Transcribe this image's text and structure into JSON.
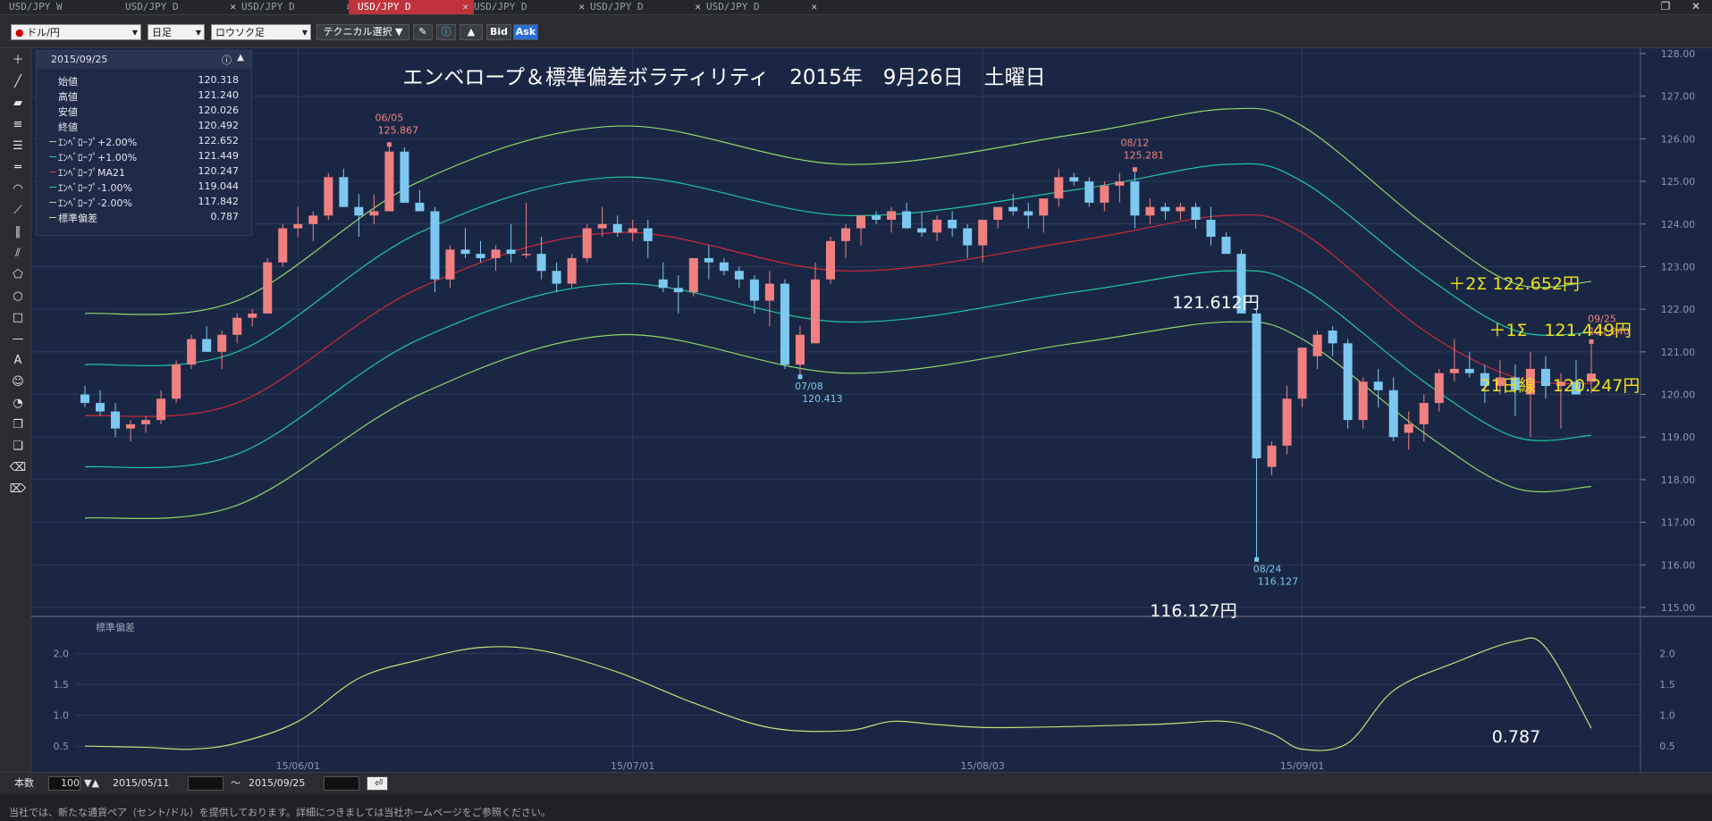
{
  "tabs": [
    {
      "label": "USD/JPY W",
      "active": false
    },
    {
      "label": "USD/JPY D",
      "active": false
    },
    {
      "label": "USD/JPY D",
      "active": false
    },
    {
      "label": "USD/JPY D",
      "active": true
    },
    {
      "label": "USD/JPY D",
      "active": false
    },
    {
      "label": "USD/JPY D",
      "active": false
    },
    {
      "label": "USD/JPY D",
      "active": false
    }
  ],
  "toolbar": {
    "pair": "ドル/円",
    "timeframe": "日足",
    "chart_style": "ロウソク足",
    "technical": "テクニカル選択",
    "bid": "Bid",
    "ask": "Ask"
  },
  "info_panel": {
    "date": "2015/09/25",
    "rows": [
      {
        "label": "始値",
        "value": "120.318",
        "color": ""
      },
      {
        "label": "高値",
        "value": "121.240",
        "color": ""
      },
      {
        "label": "安値",
        "value": "120.026",
        "color": ""
      },
      {
        "label": "終値",
        "value": "120.492",
        "color": ""
      },
      {
        "label": "ｴﾝﾍﾞﾛｰﾌﾟ+2.00%",
        "value": "122.652",
        "color": "#9be07a"
      },
      {
        "label": "ｴﾝﾍﾞﾛｰﾌﾟ+1.00%",
        "value": "121.449",
        "color": "#1fd0a0"
      },
      {
        "label": "ｴﾝﾍﾞﾛｰﾌﾟMA21",
        "value": "120.247",
        "color": "#e0303c"
      },
      {
        "label": "ｴﾝﾍﾞﾛｰﾌﾟ-1.00%",
        "value": "119.044",
        "color": "#1fd0a0"
      },
      {
        "label": "ｴﾝﾍﾞﾛｰﾌﾟ-2.00%",
        "value": "117.842",
        "color": "#9be07a"
      },
      {
        "label": "標準偏差",
        "value": "0.787",
        "color": "#c8e07a"
      }
    ]
  },
  "bottom": {
    "count_label": "本数",
    "count": "100",
    "from": "2015/05/11",
    "tilde": "～",
    "to": "2015/09/25"
  },
  "status_text": "当社では、新たな通貨ペア（セント/ドル）を提供しております。詳細につきましては当社ホームページをご参照ください。",
  "chart_data": {
    "type": "candlestick",
    "title": "エンベロープ＆標準偏差ボラティリティ　2015年　9月26日　土曜日",
    "ylim": [
      115,
      128
    ],
    "yticks": [
      "128.00",
      "127.00",
      "126.00",
      "125.00",
      "124.00",
      "123.00",
      "122.00",
      "121.00",
      "120.00",
      "119.00",
      "118.00",
      "117.00",
      "116.00",
      "115.00"
    ],
    "xticks": [
      "15/06/01",
      "15/07/01",
      "15/08/03",
      "15/09/01"
    ],
    "up_color": "#f08080",
    "down_color": "#7cc8f0",
    "candles": [
      [
        120.0,
        120.2,
        119.7,
        119.8
      ],
      [
        119.8,
        120.1,
        119.5,
        119.6
      ],
      [
        119.6,
        119.8,
        119.0,
        119.2
      ],
      [
        119.2,
        119.4,
        118.9,
        119.3
      ],
      [
        119.3,
        119.5,
        119.1,
        119.4
      ],
      [
        119.4,
        120.1,
        119.3,
        119.9
      ],
      [
        119.9,
        120.8,
        119.8,
        120.7
      ],
      [
        120.7,
        121.4,
        120.6,
        121.3
      ],
      [
        121.3,
        121.6,
        121.0,
        121.0
      ],
      [
        121.0,
        121.5,
        120.6,
        121.4
      ],
      [
        121.4,
        121.9,
        121.2,
        121.8
      ],
      [
        121.8,
        122.0,
        121.6,
        121.9
      ],
      [
        121.9,
        123.2,
        121.9,
        123.1
      ],
      [
        123.1,
        124.0,
        123.0,
        123.9
      ],
      [
        123.9,
        124.4,
        123.7,
        124.0
      ],
      [
        124.0,
        124.3,
        123.6,
        124.2
      ],
      [
        124.2,
        125.2,
        124.1,
        125.1
      ],
      [
        125.1,
        125.3,
        124.5,
        124.4
      ],
      [
        124.4,
        124.7,
        123.7,
        124.2
      ],
      [
        124.2,
        124.7,
        124.0,
        124.3
      ],
      [
        124.3,
        125.9,
        124.3,
        125.7
      ],
      [
        125.7,
        125.8,
        124.6,
        124.5
      ],
      [
        124.5,
        124.8,
        124.3,
        124.3
      ],
      [
        124.3,
        124.4,
        122.4,
        122.7
      ],
      [
        122.7,
        123.5,
        122.5,
        123.4
      ],
      [
        123.4,
        123.9,
        123.2,
        123.3
      ],
      [
        123.3,
        123.6,
        123.1,
        123.2
      ],
      [
        123.2,
        123.5,
        122.9,
        123.4
      ],
      [
        123.4,
        124.0,
        123.1,
        123.3
      ],
      [
        123.3,
        124.5,
        123.2,
        123.3
      ],
      [
        123.3,
        123.7,
        122.7,
        122.9
      ],
      [
        122.9,
        123.1,
        122.4,
        122.6
      ],
      [
        122.6,
        123.3,
        122.5,
        123.2
      ],
      [
        123.2,
        124.0,
        123.1,
        123.9
      ],
      [
        123.9,
        124.4,
        123.7,
        124.0
      ],
      [
        124.0,
        124.2,
        123.7,
        123.8
      ],
      [
        123.8,
        124.1,
        123.6,
        123.9
      ],
      [
        123.9,
        124.1,
        123.2,
        123.6
      ],
      [
        122.7,
        123.1,
        122.4,
        122.5
      ],
      [
        122.5,
        122.8,
        121.9,
        122.4
      ],
      [
        122.4,
        123.1,
        122.3,
        123.2
      ],
      [
        123.2,
        123.5,
        122.7,
        123.1
      ],
      [
        123.1,
        123.2,
        122.8,
        122.9
      ],
      [
        122.9,
        123.0,
        122.5,
        122.7
      ],
      [
        122.7,
        122.8,
        121.9,
        122.2
      ],
      [
        122.2,
        122.9,
        121.6,
        122.6
      ],
      [
        122.6,
        122.7,
        120.6,
        120.7
      ],
      [
        120.7,
        121.6,
        120.41,
        121.4
      ],
      [
        121.2,
        123.1,
        121.2,
        122.7
      ],
      [
        122.7,
        123.7,
        122.6,
        123.6
      ],
      [
        123.6,
        124.0,
        123.2,
        123.9
      ],
      [
        123.9,
        124.1,
        123.5,
        124.2
      ],
      [
        124.2,
        124.3,
        124.0,
        124.1
      ],
      [
        124.1,
        124.4,
        123.8,
        124.3
      ],
      [
        124.3,
        124.5,
        123.9,
        123.9
      ],
      [
        123.9,
        124.3,
        123.7,
        123.8
      ],
      [
        123.8,
        124.2,
        123.6,
        124.1
      ],
      [
        124.1,
        124.3,
        123.7,
        123.9
      ],
      [
        123.9,
        124.0,
        123.2,
        123.5
      ],
      [
        123.5,
        124.0,
        123.1,
        124.1
      ],
      [
        124.1,
        124.4,
        123.9,
        124.4
      ],
      [
        124.4,
        124.7,
        124.2,
        124.3
      ],
      [
        124.3,
        124.5,
        123.9,
        124.2
      ],
      [
        124.2,
        124.6,
        123.8,
        124.6
      ],
      [
        124.6,
        125.3,
        124.4,
        125.1
      ],
      [
        125.1,
        125.2,
        124.9,
        125.0
      ],
      [
        125.0,
        125.1,
        124.4,
        124.5
      ],
      [
        124.5,
        125.0,
        124.3,
        124.9
      ],
      [
        124.9,
        125.2,
        124.5,
        125.0
      ],
      [
        125.0,
        125.28,
        123.9,
        124.2
      ],
      [
        124.2,
        124.6,
        124.0,
        124.4
      ],
      [
        124.4,
        124.5,
        124.1,
        124.3
      ],
      [
        124.3,
        124.5,
        124.1,
        124.4
      ],
      [
        124.4,
        124.5,
        123.9,
        124.1
      ],
      [
        124.1,
        124.4,
        123.5,
        123.7
      ],
      [
        123.7,
        123.8,
        123.3,
        123.3
      ],
      [
        123.3,
        123.4,
        121.9,
        121.9
      ],
      [
        121.9,
        122.0,
        116.13,
        118.5
      ],
      [
        118.3,
        118.9,
        118.1,
        118.8
      ],
      [
        118.8,
        120.2,
        118.6,
        119.9
      ],
      [
        119.9,
        121.1,
        119.7,
        121.1
      ],
      [
        120.9,
        121.5,
        120.6,
        121.4
      ],
      [
        121.5,
        121.6,
        120.9,
        121.2
      ],
      [
        121.2,
        121.3,
        119.2,
        119.4
      ],
      [
        119.4,
        120.4,
        119.2,
        120.3
      ],
      [
        120.3,
        120.6,
        119.7,
        120.1
      ],
      [
        120.1,
        120.4,
        118.9,
        119.0
      ],
      [
        119.1,
        119.6,
        118.7,
        119.3
      ],
      [
        119.3,
        120.0,
        118.9,
        119.8
      ],
      [
        119.8,
        120.6,
        119.6,
        120.5
      ],
      [
        120.5,
        121.3,
        120.3,
        120.6
      ],
      [
        120.6,
        121.0,
        120.4,
        120.5
      ],
      [
        120.5,
        120.7,
        119.8,
        120.2
      ],
      [
        120.2,
        120.8,
        120.0,
        120.4
      ],
      [
        120.4,
        120.7,
        119.5,
        120.1
      ],
      [
        120.0,
        121.0,
        119.0,
        120.6
      ],
      [
        120.6,
        120.9,
        119.9,
        120.2
      ],
      [
        120.2,
        120.5,
        119.2,
        120.3
      ],
      [
        120.3,
        120.8,
        120.0,
        120.0
      ],
      [
        120.3,
        121.24,
        120.03,
        120.49
      ]
    ],
    "envelope": {
      "ma21": [
        [
          0,
          119.5
        ],
        [
          10,
          119.8
        ],
        [
          22,
          122.5
        ],
        [
          35,
          123.8
        ],
        [
          50,
          122.9
        ],
        [
          65,
          123.6
        ],
        [
          75,
          124.2
        ],
        [
          80,
          123.8
        ],
        [
          88,
          121.5
        ],
        [
          94,
          120.4
        ],
        [
          99,
          120.25
        ]
      ],
      "plus1": [
        [
          0,
          120.7
        ],
        [
          10,
          121.0
        ],
        [
          22,
          123.8
        ],
        [
          35,
          125.1
        ],
        [
          50,
          124.2
        ],
        [
          65,
          124.8
        ],
        [
          75,
          125.4
        ],
        [
          80,
          125.0
        ],
        [
          88,
          122.8
        ],
        [
          94,
          121.5
        ],
        [
          99,
          121.45
        ]
      ],
      "plus2": [
        [
          0,
          121.9
        ],
        [
          10,
          122.2
        ],
        [
          22,
          125.0
        ],
        [
          35,
          126.3
        ],
        [
          50,
          125.4
        ],
        [
          65,
          126.1
        ],
        [
          75,
          126.7
        ],
        [
          80,
          126.3
        ],
        [
          88,
          124.0
        ],
        [
          94,
          122.6
        ],
        [
          99,
          122.65
        ]
      ],
      "minus1": [
        [
          0,
          118.3
        ],
        [
          10,
          118.6
        ],
        [
          22,
          121.3
        ],
        [
          35,
          122.6
        ],
        [
          50,
          121.7
        ],
        [
          65,
          122.4
        ],
        [
          75,
          122.9
        ],
        [
          80,
          122.5
        ],
        [
          88,
          120.3
        ],
        [
          94,
          119.0
        ],
        [
          99,
          119.04
        ]
      ],
      "minus2": [
        [
          0,
          117.1
        ],
        [
          10,
          117.4
        ],
        [
          22,
          120.0
        ],
        [
          35,
          121.4
        ],
        [
          50,
          120.5
        ],
        [
          65,
          121.2
        ],
        [
          75,
          121.7
        ],
        [
          80,
          121.3
        ],
        [
          88,
          119.1
        ],
        [
          94,
          117.8
        ],
        [
          99,
          117.84
        ]
      ]
    },
    "sd": {
      "label": "標準偏差",
      "ylim": [
        0.3,
        2.4
      ],
      "yticks": [
        "2.0",
        "1.5",
        "1.0",
        "0.5"
      ],
      "values": [
        [
          0,
          0.5
        ],
        [
          4,
          0.48
        ],
        [
          7,
          0.45
        ],
        [
          10,
          0.55
        ],
        [
          14,
          0.9
        ],
        [
          18,
          1.6
        ],
        [
          22,
          1.9
        ],
        [
          26,
          2.1
        ],
        [
          30,
          2.05
        ],
        [
          35,
          1.7
        ],
        [
          40,
          1.2
        ],
        [
          45,
          0.8
        ],
        [
          50,
          0.75
        ],
        [
          53,
          0.9
        ],
        [
          56,
          0.85
        ],
        [
          60,
          0.8
        ],
        [
          70,
          0.85
        ],
        [
          75,
          0.9
        ],
        [
          78,
          0.7
        ],
        [
          80,
          0.45
        ],
        [
          83,
          0.55
        ],
        [
          86,
          1.4
        ],
        [
          90,
          1.85
        ],
        [
          94,
          2.2
        ],
        [
          96,
          2.1
        ],
        [
          99,
          0.79
        ]
      ]
    },
    "annotations": {
      "h1": {
        "date": "06/05",
        "price": "125.867"
      },
      "l1": {
        "date": "07/08",
        "price": "120.413"
      },
      "h2": {
        "date": "08/12",
        "price": "125.281"
      },
      "l2": {
        "date": "08/24",
        "price": "116.127"
      },
      "last": {
        "date": "09/25",
        "price": "121.240"
      },
      "big_high": "121.612円",
      "big_low": "116.127円",
      "plus2": "＋2Σ 122.652円",
      "plus1": "＋1Σ　121.449円",
      "ma21": "21日線　120.247円",
      "sd_last": "0.787"
    }
  }
}
